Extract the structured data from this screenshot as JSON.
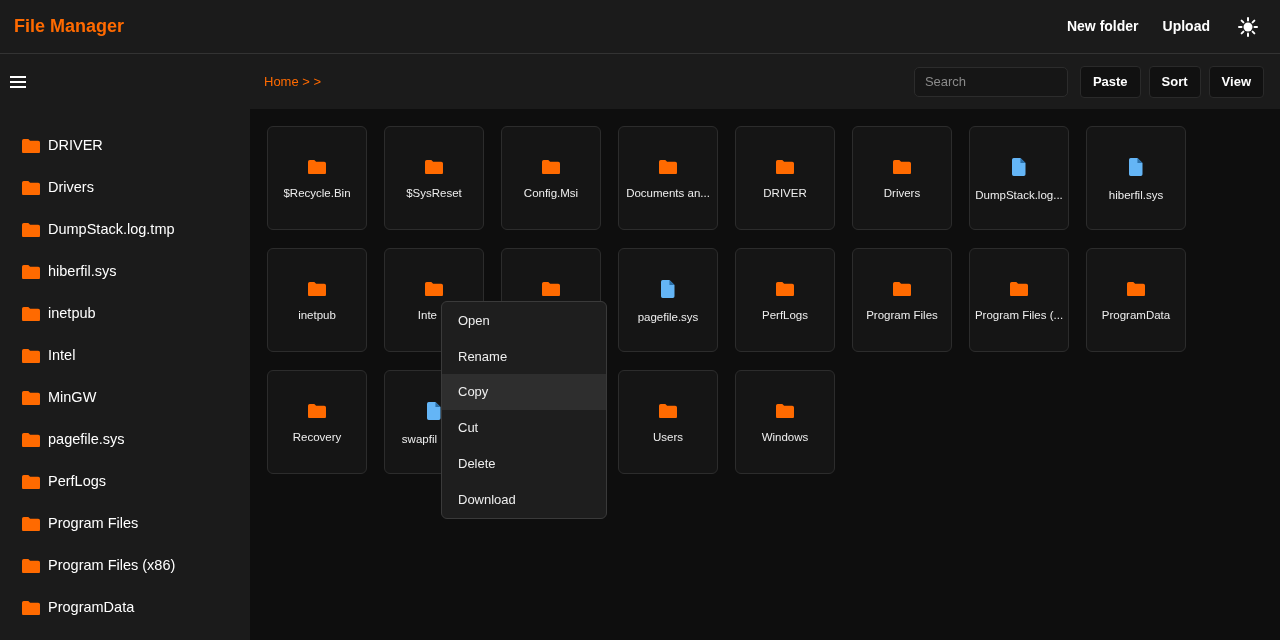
{
  "app": {
    "title": "File Manager",
    "actions": [
      "New folder",
      "Upload"
    ]
  },
  "toolbar": {
    "breadcrumb": "Home > >",
    "search": {
      "placeholder": "Search"
    },
    "buttons": [
      "Paste",
      "Sort",
      "View"
    ]
  },
  "sidebar": {
    "items": [
      {
        "name": "DRIVER"
      },
      {
        "name": "Drivers"
      },
      {
        "name": "DumpStack.log.tmp"
      },
      {
        "name": "hiberfil.sys"
      },
      {
        "name": "inetpub"
      },
      {
        "name": "Intel"
      },
      {
        "name": "MinGW"
      },
      {
        "name": "pagefile.sys"
      },
      {
        "name": "PerfLogs"
      },
      {
        "name": "Program Files"
      },
      {
        "name": "Program Files (x86)"
      },
      {
        "name": "ProgramData"
      }
    ]
  },
  "grid": {
    "items": [
      {
        "kind": "folder",
        "name": "$Recycle.Bin"
      },
      {
        "kind": "folder",
        "name": "$SysReset"
      },
      {
        "kind": "folder",
        "name": "Config.Msi"
      },
      {
        "kind": "folder",
        "name": "Documents an..."
      },
      {
        "kind": "folder",
        "name": "DRIVER"
      },
      {
        "kind": "folder",
        "name": "Drivers"
      },
      {
        "kind": "file",
        "name": "DumpStack.log..."
      },
      {
        "kind": "file",
        "name": "hiberfil.sys"
      },
      {
        "kind": "folder",
        "name": "inetpub"
      },
      {
        "kind": "folder",
        "name": "Inte",
        "cut_off": true
      },
      {
        "kind": "folder"
      },
      {
        "kind": "file",
        "name": "pagefile.sys"
      },
      {
        "kind": "folder",
        "name": "PerfLogs"
      },
      {
        "kind": "folder",
        "name": "Program Files"
      },
      {
        "kind": "folder",
        "name": "Program Files (..."
      },
      {
        "kind": "folder",
        "name": "ProgramData"
      },
      {
        "kind": "folder",
        "name": "Recovery"
      },
      {
        "kind": "file",
        "name": "swapfil",
        "cut_off": true
      },
      {
        "kind": "covered"
      },
      {
        "kind": "folder",
        "name": "Users"
      },
      {
        "kind": "folder",
        "name": "Windows"
      }
    ]
  },
  "context_menu": {
    "items": [
      {
        "label": "Open",
        "highlighted": false
      },
      {
        "label": "Rename",
        "highlighted": false
      },
      {
        "label": "Copy",
        "highlighted": true
      },
      {
        "label": "Cut",
        "highlighted": false
      },
      {
        "label": "Delete",
        "highlighted": false
      },
      {
        "label": "Download",
        "highlighted": false
      }
    ]
  }
}
